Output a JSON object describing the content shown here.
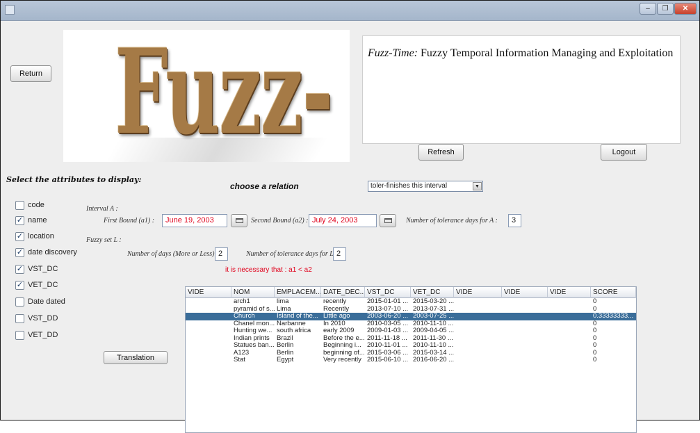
{
  "window": {
    "title": "",
    "controls": [
      "minimize",
      "restore",
      "close"
    ]
  },
  "buttons": {
    "return_label": "Return",
    "refresh_label": "Refresh",
    "logout_label": "Logout",
    "translation_label": "Translation"
  },
  "logo": {
    "text": "Fuzz-Time"
  },
  "info": {
    "prefix": "Fuzz-Time:",
    "text": " Fuzzy Temporal Information Managing and Exploitation"
  },
  "attributes": {
    "title": "Select the attributes to display:",
    "items": [
      {
        "label": "code",
        "checked": false
      },
      {
        "label": "name",
        "checked": true
      },
      {
        "label": "location",
        "checked": true
      },
      {
        "label": "date discovery",
        "checked": true
      },
      {
        "label": "VST_DC",
        "checked": true
      },
      {
        "label": "VET_DC",
        "checked": true
      },
      {
        "label": "Date dated",
        "checked": false
      },
      {
        "label": "VST_DD",
        "checked": false
      },
      {
        "label": "VET_DD",
        "checked": false
      }
    ]
  },
  "relation": {
    "title": "choose a relation",
    "selected": "toler-finishes this interval"
  },
  "interval": {
    "label": "Interval A :",
    "first_bound_label": "First Bound (a1) :",
    "first_bound_value": "June 19, 2003",
    "second_bound_label": "Second Bound (a2) :",
    "second_bound_value": "July 24, 2003",
    "tolerance_a_label": "Number of tolerance days for A :",
    "tolerance_a_value": "3"
  },
  "fuzzy": {
    "label": "Fuzzy set L :",
    "days_label": "Number of days (More or Less) :",
    "days_value": "2",
    "tolerance_l_label": "Number of tolerance days for L :",
    "tolerance_l_value": "2"
  },
  "warning": "it is necessary that : a1 < a2",
  "table": {
    "columns": [
      "VIDE",
      "NOM",
      "EMPLACEM...",
      "DATE_DEC...",
      "VST_DC",
      "VET_DC",
      "VIDE",
      "VIDE",
      "VIDE",
      "SCORE"
    ],
    "selected_row": 2,
    "rows": [
      [
        "",
        "arch1",
        "lima",
        "recently",
        "2015-01-01 ...",
        "2015-03-20 ...",
        "",
        "",
        "",
        "0"
      ],
      [
        "",
        "pyramid of s...",
        "Lima",
        "Recently",
        "2013-07-10 ...",
        "2013-07-31 ...",
        "",
        "",
        "",
        "0"
      ],
      [
        "",
        "Church",
        "Island of the...",
        "Little ago",
        "2003-06-20 ...",
        "2003-07-25 ...",
        "",
        "",
        "",
        "0.33333333..."
      ],
      [
        "",
        "Chanel mon...",
        "Narbanne",
        "In 2010",
        "2010-03-05 ...",
        "2010-11-10 ...",
        "",
        "",
        "",
        "0"
      ],
      [
        "",
        "Hunting we...",
        "south africa",
        "early 2009",
        "2009-01-03 ...",
        "2009-04-05 ...",
        "",
        "",
        "",
        "0"
      ],
      [
        "",
        "Indian prints",
        "Brazil",
        "Before the e...",
        "2011-11-18 ...",
        "2011-11-30 ...",
        "",
        "",
        "",
        "0"
      ],
      [
        "",
        "Statues ban...",
        "Berlin",
        "Beginning i...",
        "2010-11-01 ...",
        "2010-11-10 ...",
        "",
        "",
        "",
        "0"
      ],
      [
        "",
        "A123",
        "Berlin",
        "beginning of...",
        "2015-03-06 ...",
        "2015-03-14 ...",
        "",
        "",
        "",
        "0"
      ],
      [
        "",
        "Stat",
        "Egypt",
        "Very recently",
        "2015-06-10 ...",
        "2016-06-20 ...",
        "",
        "",
        "",
        "0"
      ]
    ]
  }
}
